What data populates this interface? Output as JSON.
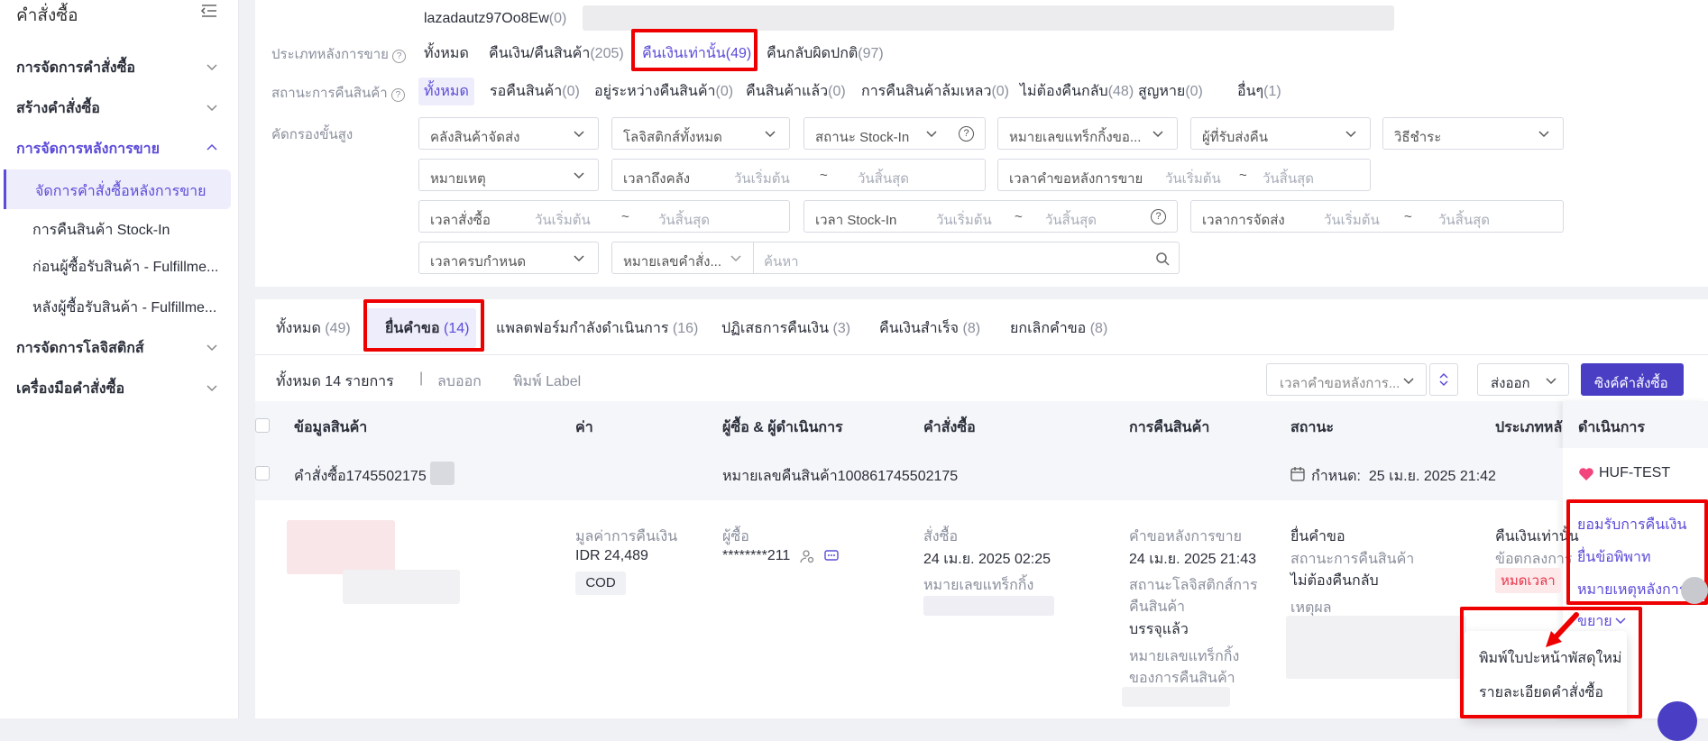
{
  "sidebar": {
    "title": "คำสั่งซื้อ",
    "groups": [
      {
        "label": "การจัดการคำสั่งซื้อ"
      },
      {
        "label": "สร้างคำสั่งซื้อ"
      },
      {
        "label": "การจัดการหลังการขาย"
      },
      {
        "label": "การจัดการโลจิสติกส์"
      },
      {
        "label": "เครื่องมือคำสั่งซื้อ"
      }
    ],
    "subitems": [
      {
        "label": "จัดการคำสั่งซื้อหลังการขาย"
      },
      {
        "label": "การคืนสินค้า Stock-In"
      },
      {
        "label": "ก่อนผู้ซื้อรับสินค้า - Fulfillme..."
      },
      {
        "label": "หลังผู้ซื้อรับสินค้า - Fulfillme..."
      }
    ]
  },
  "account": {
    "name": "lazadautz97Oo8Ew",
    "count": "(0)"
  },
  "filters": {
    "sale_type_label": "ประเภทหลังการขาย",
    "sale_types": [
      {
        "label": "ทั้งหมด",
        "count": ""
      },
      {
        "label": "คืนเงิน/คืนสินค้า",
        "count": "(205)"
      },
      {
        "label": "คืนเงินเท่านั้น",
        "count": "(49)"
      },
      {
        "label": "คืนกลับผิดปกติ",
        "count": "(97)"
      }
    ],
    "return_status_label": "สถานะการคืนสินค้า",
    "return_statuses": [
      {
        "label": "ทั้งหมด",
        "count": ""
      },
      {
        "label": "รอคืนสินค้า",
        "count": "(0)"
      },
      {
        "label": "อยู่ระหว่างคืนสินค้า",
        "count": "(0)"
      },
      {
        "label": "คืนสินค้าแล้ว",
        "count": "(0)"
      },
      {
        "label": "การคืนสินค้าล้มเหลว",
        "count": "(0)"
      },
      {
        "label": "ไม่ต้องคืนกลับ",
        "count": "(48)"
      },
      {
        "label": "สูญหาย",
        "count": "(0)"
      },
      {
        "label": "อื่นๆ",
        "count": "(1)"
      }
    ],
    "advanced_label": "คัดกรองขั้นสูง",
    "warehouse": "คลังสินค้าจัดส่ง",
    "logistics": "โลจิสติกส์ทั้งหมด",
    "stockin_status": "สถานะ Stock-In",
    "tracking_no": "หมายเลขแทร็กกิ้งขอ...",
    "return_receiver": "ผู้ที่รับส่งคืน",
    "payment": "วิธีชำระ",
    "reason": "หมายเหตุ",
    "warehouse_time": "เวลาถึงคลัง",
    "request_time": "เวลาคำขอหลังการขาย",
    "order_time": "เวลาสั่งซื้อ",
    "stockin_time": "เวลา Stock-In",
    "ship_time": "เวลาการจัดส่ง",
    "due_time": "เวลาครบกำหนด",
    "order_no_select": "หมายเลขคำสั่ง...",
    "start_ph": "วันเริ่มต้น",
    "end_ph": "วันสิ้นสุด",
    "tilde": "~",
    "search_ph": "ค้นหา"
  },
  "tabs": [
    {
      "label": "ทั้งหมด",
      "count": "(49)"
    },
    {
      "label": "ยื่นคำขอ",
      "count": "(14)"
    },
    {
      "label": "แพลตฟอร์มกำลังดำเนินการ",
      "count": "(16)"
    },
    {
      "label": "ปฏิเสธการคืนเงิน",
      "count": "(3)"
    },
    {
      "label": "คืนเงินสำเร็จ",
      "count": "(8)"
    },
    {
      "label": "ยกเลิกคำขอ",
      "count": "(8)"
    }
  ],
  "toolbar": {
    "total": "ทั้งหมด 14 รายการ",
    "separator": "|",
    "delete": "ลบออก",
    "print_label": "พิมพ์ Label",
    "sort": "เวลาคำขอหลังการ...",
    "export": "ส่งออก",
    "sync": "ซิงค์คำสั่งซื้อ"
  },
  "columns": [
    "ข้อมูลสินค้า",
    "ค่า",
    "ผู้ซื้อ & ผู้ดำเนินการ",
    "คำสั่งซื้อ",
    "การคืนสินค้า",
    "สถานะ",
    "ประเภทหลัง",
    "ดำเนินการ"
  ],
  "order": {
    "order_label": "คำสั่งซื้อ",
    "order_no": "1745502175",
    "return_no_label": "หมายเลขคืนสินค้า",
    "return_no": "100861745502175",
    "due_label": "กำหนด:",
    "due_value": "25 เม.ย. 2025 21:42",
    "shop": "HUF-TEST",
    "refund_label": "มูลค่าการคืนเงิน",
    "refund_value": "IDR 24,489",
    "payment": "COD",
    "buyer_label": "ผู้ซื้อ",
    "buyer": "********211",
    "order_time_label": "สั่งซื้อ",
    "order_time": "24 เม.ย. 2025 02:25",
    "tracking_label": "หมายเลขแทร็กกิ้ง",
    "request_label": "คำขอหลังการขาย",
    "request_time": "24 เม.ย. 2025 21:43",
    "logistics_status_label": "สถานะโลจิสติกส์การ",
    "logistics_status_label2": "คืนสินค้า",
    "logistics_status": "บรรจุแล้ว",
    "return_tracking_label": "หมายเลขแทร็กกิ้ง",
    "return_tracking_label2": "ของการคืนสินค้า",
    "status": "ยื่นคำขอ",
    "return_status_label": "สถานะการคืนสินค้า",
    "return_status": "ไม่ต้องคืนกลับ",
    "reason_label": "เหตุผล",
    "sale_type": "คืนเงินเท่านั้น",
    "agreement": "ข้อตกลงการ",
    "expired": "หมดเวลา"
  },
  "actions": {
    "accept": "ยอมรับการคืนเงิน",
    "dispute": "ยื่นข้อพิพาท",
    "note": "หมายเหตุหลังการข",
    "more": "ขยาย",
    "menu": [
      "พิมพ์ใบปะหน้าพัสดุใหม่",
      "รายละเอียดคำสั่งซื้อ"
    ]
  },
  "colors": {
    "accent": "#5b4bd8",
    "highlight": "#e00000",
    "danger": "#e8334a"
  }
}
